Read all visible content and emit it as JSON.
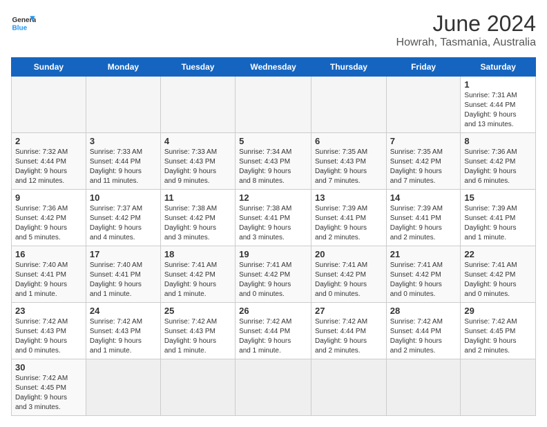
{
  "header": {
    "logo_text_general": "General",
    "logo_text_blue": "Blue",
    "month": "June 2024",
    "location": "Howrah, Tasmania, Australia"
  },
  "weekdays": [
    "Sunday",
    "Monday",
    "Tuesday",
    "Wednesday",
    "Thursday",
    "Friday",
    "Saturday"
  ],
  "weeks": [
    [
      {
        "day": "",
        "info": ""
      },
      {
        "day": "",
        "info": ""
      },
      {
        "day": "",
        "info": ""
      },
      {
        "day": "",
        "info": ""
      },
      {
        "day": "",
        "info": ""
      },
      {
        "day": "",
        "info": ""
      },
      {
        "day": "1",
        "info": "Sunrise: 7:31 AM\nSunset: 4:44 PM\nDaylight: 9 hours\nand 13 minutes."
      }
    ],
    [
      {
        "day": "2",
        "info": "Sunrise: 7:32 AM\nSunset: 4:44 PM\nDaylight: 9 hours\nand 12 minutes."
      },
      {
        "day": "3",
        "info": "Sunrise: 7:33 AM\nSunset: 4:44 PM\nDaylight: 9 hours\nand 11 minutes."
      },
      {
        "day": "4",
        "info": "Sunrise: 7:33 AM\nSunset: 4:43 PM\nDaylight: 9 hours\nand 9 minutes."
      },
      {
        "day": "5",
        "info": "Sunrise: 7:34 AM\nSunset: 4:43 PM\nDaylight: 9 hours\nand 8 minutes."
      },
      {
        "day": "6",
        "info": "Sunrise: 7:35 AM\nSunset: 4:43 PM\nDaylight: 9 hours\nand 7 minutes."
      },
      {
        "day": "7",
        "info": "Sunrise: 7:35 AM\nSunset: 4:42 PM\nDaylight: 9 hours\nand 7 minutes."
      },
      {
        "day": "8",
        "info": "Sunrise: 7:36 AM\nSunset: 4:42 PM\nDaylight: 9 hours\nand 6 minutes."
      }
    ],
    [
      {
        "day": "9",
        "info": "Sunrise: 7:36 AM\nSunset: 4:42 PM\nDaylight: 9 hours\nand 5 minutes."
      },
      {
        "day": "10",
        "info": "Sunrise: 7:37 AM\nSunset: 4:42 PM\nDaylight: 9 hours\nand 4 minutes."
      },
      {
        "day": "11",
        "info": "Sunrise: 7:38 AM\nSunset: 4:42 PM\nDaylight: 9 hours\nand 3 minutes."
      },
      {
        "day": "12",
        "info": "Sunrise: 7:38 AM\nSunset: 4:41 PM\nDaylight: 9 hours\nand 3 minutes."
      },
      {
        "day": "13",
        "info": "Sunrise: 7:39 AM\nSunset: 4:41 PM\nDaylight: 9 hours\nand 2 minutes."
      },
      {
        "day": "14",
        "info": "Sunrise: 7:39 AM\nSunset: 4:41 PM\nDaylight: 9 hours\nand 2 minutes."
      },
      {
        "day": "15",
        "info": "Sunrise: 7:39 AM\nSunset: 4:41 PM\nDaylight: 9 hours\nand 1 minute."
      }
    ],
    [
      {
        "day": "16",
        "info": "Sunrise: 7:40 AM\nSunset: 4:41 PM\nDaylight: 9 hours\nand 1 minute."
      },
      {
        "day": "17",
        "info": "Sunrise: 7:40 AM\nSunset: 4:41 PM\nDaylight: 9 hours\nand 1 minute."
      },
      {
        "day": "18",
        "info": "Sunrise: 7:41 AM\nSunset: 4:42 PM\nDaylight: 9 hours\nand 1 minute."
      },
      {
        "day": "19",
        "info": "Sunrise: 7:41 AM\nSunset: 4:42 PM\nDaylight: 9 hours\nand 0 minutes."
      },
      {
        "day": "20",
        "info": "Sunrise: 7:41 AM\nSunset: 4:42 PM\nDaylight: 9 hours\nand 0 minutes."
      },
      {
        "day": "21",
        "info": "Sunrise: 7:41 AM\nSunset: 4:42 PM\nDaylight: 9 hours\nand 0 minutes."
      },
      {
        "day": "22",
        "info": "Sunrise: 7:41 AM\nSunset: 4:42 PM\nDaylight: 9 hours\nand 0 minutes."
      }
    ],
    [
      {
        "day": "23",
        "info": "Sunrise: 7:42 AM\nSunset: 4:43 PM\nDaylight: 9 hours\nand 0 minutes."
      },
      {
        "day": "24",
        "info": "Sunrise: 7:42 AM\nSunset: 4:43 PM\nDaylight: 9 hours\nand 1 minute."
      },
      {
        "day": "25",
        "info": "Sunrise: 7:42 AM\nSunset: 4:43 PM\nDaylight: 9 hours\nand 1 minute."
      },
      {
        "day": "26",
        "info": "Sunrise: 7:42 AM\nSunset: 4:44 PM\nDaylight: 9 hours\nand 1 minute."
      },
      {
        "day": "27",
        "info": "Sunrise: 7:42 AM\nSunset: 4:44 PM\nDaylight: 9 hours\nand 2 minutes."
      },
      {
        "day": "28",
        "info": "Sunrise: 7:42 AM\nSunset: 4:44 PM\nDaylight: 9 hours\nand 2 minutes."
      },
      {
        "day": "29",
        "info": "Sunrise: 7:42 AM\nSunset: 4:45 PM\nDaylight: 9 hours\nand 2 minutes."
      }
    ],
    [
      {
        "day": "30",
        "info": "Sunrise: 7:42 AM\nSunset: 4:45 PM\nDaylight: 9 hours\nand 3 minutes."
      },
      {
        "day": "",
        "info": ""
      },
      {
        "day": "",
        "info": ""
      },
      {
        "day": "",
        "info": ""
      },
      {
        "day": "",
        "info": ""
      },
      {
        "day": "",
        "info": ""
      },
      {
        "day": "",
        "info": ""
      }
    ]
  ]
}
